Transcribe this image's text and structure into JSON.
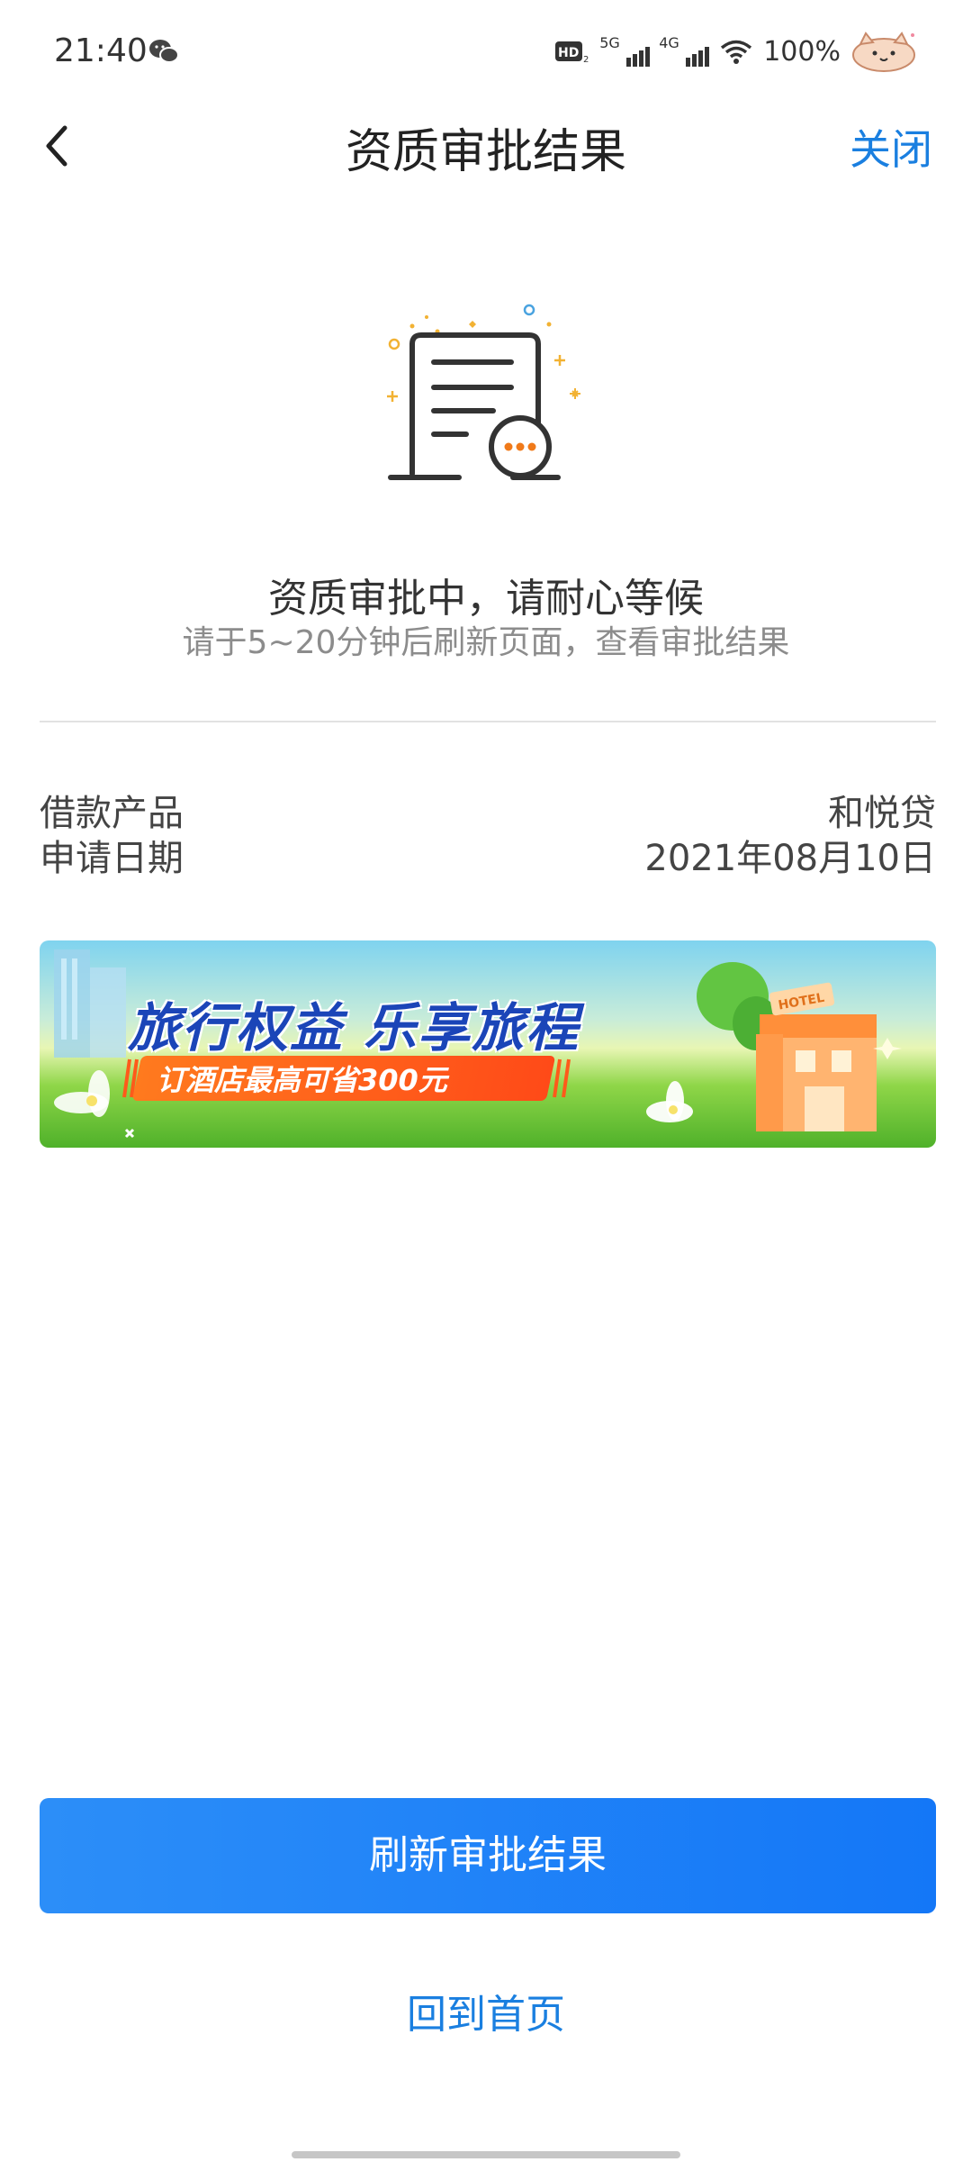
{
  "status_bar": {
    "time": "21:40",
    "battery": "100%",
    "network_1": "5G",
    "network_2": "4G",
    "icons": [
      "wechat-icon",
      "hd-icon",
      "signal-icon",
      "wifi-icon",
      "cat-avatar-icon"
    ]
  },
  "nav": {
    "title": "资质审批结果",
    "close_label": "关闭",
    "back_icon": "chevron-left-icon"
  },
  "status": {
    "title": "资质审批中，请耐心等候",
    "subtitle": "请于5~20分钟后刷新页面，查看审批结果",
    "illustration": "document-pending-icon"
  },
  "info": [
    {
      "key": "借款产品",
      "value": "和悦贷"
    },
    {
      "key": "申请日期",
      "value": "2021年08月10日"
    }
  ],
  "banner": {
    "title": "旅行权益 乐享旅程",
    "tag": "订酒店最高可省300元",
    "hotel_sign": "HOTEL"
  },
  "actions": {
    "primary": "刷新审批结果",
    "secondary": "回到首页"
  },
  "colors": {
    "accent": "#1a7fe0",
    "primary_button": "#1e83f7",
    "banner_tag": "#ff5a1a"
  }
}
